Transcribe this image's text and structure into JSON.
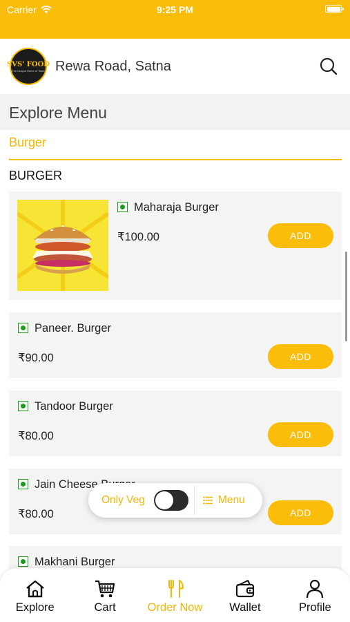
{
  "status_bar": {
    "carrier": "Carrier",
    "time": "9:25 PM",
    "battery_level": 1.0
  },
  "header": {
    "logo_text": "SVS' FOOD",
    "logo_tagline": "The Unique Home of Taste",
    "location": "Rewa Road, Satna",
    "search_icon": "search-icon"
  },
  "section": {
    "title": "Explore Menu"
  },
  "category": {
    "tab_label": "Burger",
    "heading": "BURGER"
  },
  "items": [
    {
      "name": "Maharaja  Burger",
      "price": "₹100.00",
      "add_label": "ADD"
    },
    {
      "name": "Paneer. Burger",
      "price": "₹90.00",
      "add_label": "ADD"
    },
    {
      "name": "Tandoor Burger",
      "price": "₹80.00",
      "add_label": "ADD"
    },
    {
      "name": "Jain Cheese Burger",
      "price": "₹80.00",
      "add_label": "ADD"
    },
    {
      "name": "Makhani Burger"
    }
  ],
  "filter": {
    "only_veg_label": "Only Veg",
    "only_veg_on": false,
    "menu_label": "Menu"
  },
  "bottom_nav": [
    {
      "label": "Explore",
      "icon": "home-icon"
    },
    {
      "label": "Cart",
      "icon": "cart-icon"
    },
    {
      "label": "Order Now",
      "icon": "fork-knife-icon",
      "active": true
    },
    {
      "label": "Wallet",
      "icon": "wallet-icon"
    },
    {
      "label": "Profile",
      "icon": "profile-icon"
    }
  ],
  "colors": {
    "accent": "#fbbd0a",
    "veg_green": "#1a9b1a",
    "card_bg": "#f4f4f4"
  }
}
